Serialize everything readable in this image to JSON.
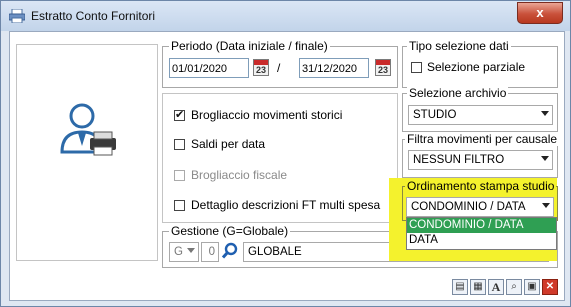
{
  "window": {
    "title": "Estratto Conto Fornitori",
    "close_glyph": "x"
  },
  "periodo": {
    "legend": "Periodo (Data iniziale / finale)",
    "start": "01/01/2020",
    "separator": "/",
    "end": "31/12/2020",
    "calendar_day": "23"
  },
  "tipo_selezione": {
    "legend": "Tipo selezione dati",
    "option_label": "Selezione parziale",
    "checked": false
  },
  "options": [
    {
      "label": "Brogliaccio movimenti storici",
      "checked": true,
      "disabled": false
    },
    {
      "label": "Saldi per data",
      "checked": false,
      "disabled": false
    },
    {
      "label": "Brogliaccio fiscale",
      "checked": false,
      "disabled": true
    },
    {
      "label": "Dettaglio descrizioni FT multi spesa",
      "checked": false,
      "disabled": false
    }
  ],
  "archivio": {
    "legend": "Selezione archivio",
    "value": "STUDIO"
  },
  "causale": {
    "legend": "Filtra movimenti per causale",
    "value": "NESSUN FILTRO"
  },
  "ordinamento": {
    "legend": "Ordinamento stampa studio",
    "value": "CONDOMINIO / DATA",
    "options": [
      "CONDOMINIO / DATA",
      "DATA"
    ],
    "highlight_color": "#f4f22d",
    "selected_color": "#2f9f53"
  },
  "gestione": {
    "legend": "Gestione (G=Globale)",
    "code": "G",
    "number": "0",
    "value": "GLOBALE"
  },
  "toolbar": [
    {
      "icon": "document-icon",
      "glyph": "▤"
    },
    {
      "icon": "grid-icon",
      "glyph": "▦"
    },
    {
      "icon": "font-icon",
      "glyph": "A"
    },
    {
      "icon": "preview-icon",
      "glyph": "⌕"
    },
    {
      "icon": "print-icon",
      "glyph": "▣"
    },
    {
      "icon": "close-icon",
      "glyph": "✕"
    }
  ]
}
